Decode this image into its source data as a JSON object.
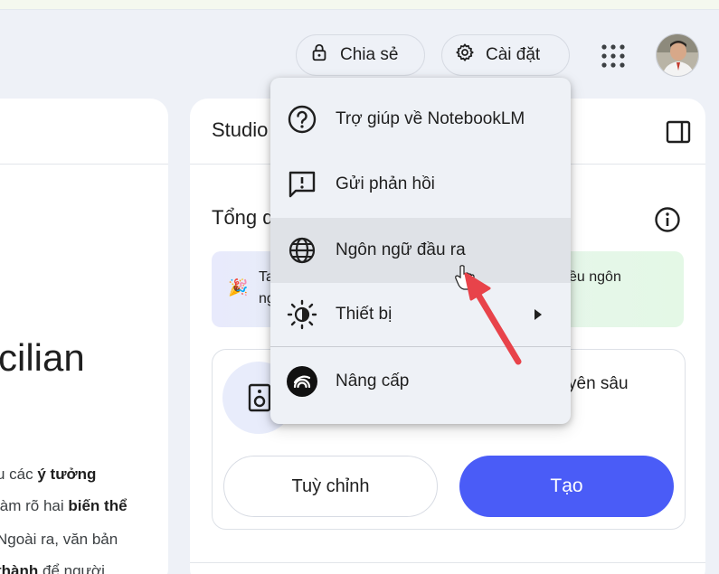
{
  "header": {
    "share_label": "Chia sẻ",
    "settings_label": "Cài đặt"
  },
  "left_panel": {
    "title_fragment": "cilian",
    "lines": [
      {
        "plain": "u các ",
        "bold": "ý tưởng",
        "after": ""
      },
      {
        "plain": "làm rõ hai ",
        "bold": "biến thể",
        "after": ""
      },
      {
        "plain": "Ngoài ra, văn bản",
        "bold": "",
        "after": ""
      },
      {
        "plain": "",
        "bold": "thành",
        "after": " để người"
      }
    ]
  },
  "studio": {
    "title": "Studio",
    "overview_title": "Tổng q",
    "banner": {
      "line1": "Ta",
      "line2": "ng",
      "right_text": "ều ngôn"
    },
    "card": {
      "right_text": "yên sâu"
    },
    "customize_label": "Tuỳ chỉnh",
    "create_label": "Tạo",
    "accent_color": "#4a5cf7"
  },
  "menu": {
    "items": [
      {
        "label": "Trợ giúp về NotebookLM",
        "icon": "help-circle-icon"
      },
      {
        "label": "Gửi phản hồi",
        "icon": "feedback-icon"
      },
      {
        "label": "Ngôn ngữ đầu ra",
        "icon": "globe-icon"
      },
      {
        "label": "Thiết bị",
        "icon": "brightness-icon"
      },
      {
        "label": "Nâng cấp",
        "icon": "upgrade-icon"
      }
    ],
    "active_index": 2,
    "arrow_color": "#e8434a"
  }
}
